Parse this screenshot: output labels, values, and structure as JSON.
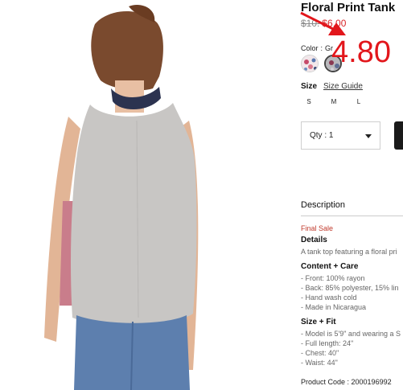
{
  "product": {
    "title": "Floral Print Tank",
    "original_price": "$10.",
    "sale_price": "$6.00",
    "color_label": "Color",
    "color_sep": ":",
    "color_value": "Gr",
    "size_label": "Size",
    "size_guide": "Size Guide",
    "sizes": [
      "S",
      "M",
      "L"
    ],
    "qty_label": "Qty : 1",
    "description_heading": "Description",
    "final_sale": "Final Sale",
    "details_title": "Details",
    "details_text": "A tank top featuring a floral pri",
    "content_title": "Content + Care",
    "content_items": [
      "- Front: 100% rayon",
      "- Back: 85% polyester, 15% lin",
      "- Hand wash cold",
      "- Made in Nicaragua"
    ],
    "fit_title": "Size + Fit",
    "fit_items": [
      "- Model is 5'9\" and wearing a S",
      "- Full length: 24\"",
      "- Chest: 40\"",
      "- Waist: 44\""
    ],
    "product_code": "Product Code : 2000196992"
  },
  "overlay": {
    "price_text": "4.80"
  },
  "colors": {
    "sale": "#d8262a",
    "overlay": "#e2161b",
    "final_sale": "#c0392b",
    "button": "#1a1a1a"
  },
  "icons": {
    "dropdown": "caret-down-icon",
    "annotation": "red-arrow-icon"
  }
}
